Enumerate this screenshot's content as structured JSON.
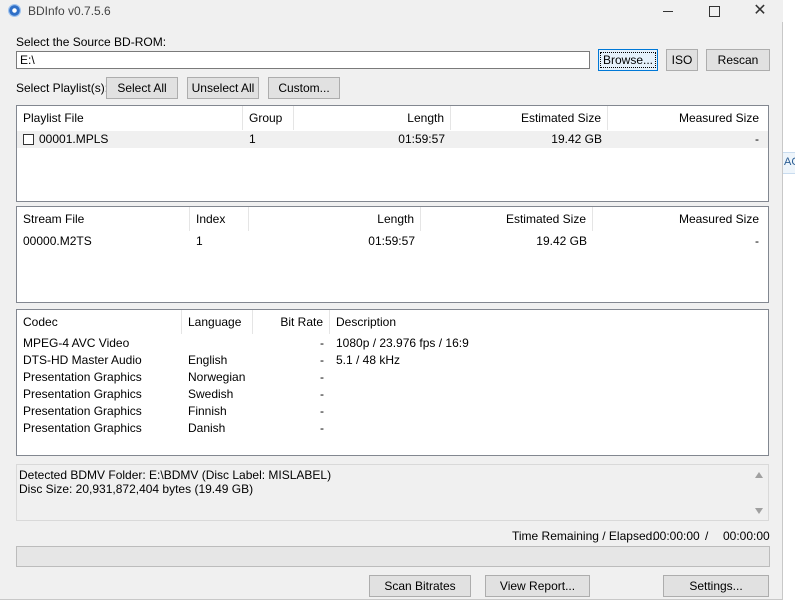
{
  "window": {
    "title": "BDInfo v0.7.5.6",
    "close_glyph": "✕"
  },
  "source": {
    "label": "Select the Source BD-ROM:",
    "path": "E:\\",
    "browse": "Browse...",
    "iso": "ISO",
    "rescan": "Rescan"
  },
  "playlist_controls": {
    "label": "Select Playlist(s):",
    "select_all": "Select All",
    "unselect_all": "Unselect All",
    "custom": "Custom..."
  },
  "playlist_table": {
    "headers": [
      "Playlist File",
      "Group",
      "Length",
      "Estimated Size",
      "Measured Size"
    ],
    "rows": [
      {
        "file": "00001.MPLS",
        "group": "1",
        "length": "01:59:57",
        "estimated": "19.42 GB",
        "measured": "-"
      }
    ]
  },
  "stream_table": {
    "headers": [
      "Stream File",
      "Index",
      "Length",
      "Estimated Size",
      "Measured Size"
    ],
    "rows": [
      {
        "file": "00000.M2TS",
        "index": "1",
        "length": "01:59:57",
        "estimated": "19.42 GB",
        "measured": "-"
      }
    ]
  },
  "codec_table": {
    "headers": [
      "Codec",
      "Language",
      "Bit Rate",
      "Description"
    ],
    "rows": [
      {
        "codec": "MPEG-4 AVC Video",
        "language": "",
        "bitrate": "-",
        "description": "1080p / 23.976 fps / 16:9"
      },
      {
        "codec": "DTS-HD Master Audio",
        "language": "English",
        "bitrate": "-",
        "description": "5.1 / 48 kHz"
      },
      {
        "codec": "Presentation Graphics",
        "language": "Norwegian",
        "bitrate": "-",
        "description": ""
      },
      {
        "codec": "Presentation Graphics",
        "language": "Swedish",
        "bitrate": "-",
        "description": ""
      },
      {
        "codec": "Presentation Graphics",
        "language": "Finnish",
        "bitrate": "-",
        "description": ""
      },
      {
        "codec": "Presentation Graphics",
        "language": "Danish",
        "bitrate": "-",
        "description": ""
      }
    ]
  },
  "info": {
    "line1": "Detected BDMV Folder: E:\\BDMV (Disc Label: MISLABEL)",
    "line2": "Disc Size: 20,931,872,404 bytes (19.49 GB)"
  },
  "time": {
    "label": "Time Remaining / Elapsed:",
    "remaining": "00:00:00",
    "separator": "/",
    "elapsed": "00:00:00"
  },
  "progress": {
    "value": 0
  },
  "bottom_buttons": {
    "scan": "Scan Bitrates",
    "report": "View Report...",
    "settings": "Settings..."
  },
  "edge_fragment": "AC"
}
